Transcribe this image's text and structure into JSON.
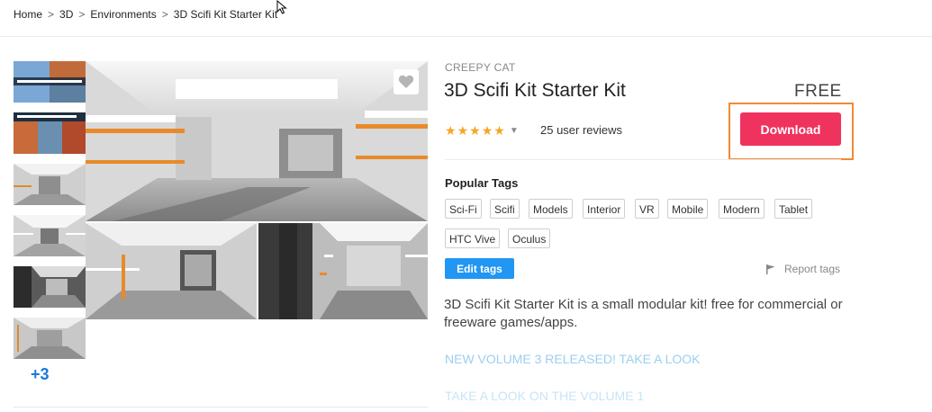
{
  "breadcrumb": {
    "items": [
      "Home",
      "3D",
      "Environments",
      "3D Scifi Kit Starter Kit"
    ],
    "separator": ">"
  },
  "gallery": {
    "more_count": "+3",
    "thumbnails": [
      {
        "icon": "thumbnail-volume-promo-1"
      },
      {
        "icon": "thumbnail-volume-promo-2"
      },
      {
        "icon": "thumbnail-corridor-1"
      },
      {
        "icon": "thumbnail-corridor-2"
      },
      {
        "icon": "thumbnail-corridor-3"
      },
      {
        "icon": "thumbnail-corridor-4"
      }
    ],
    "favorite_icon": "heart-icon"
  },
  "product": {
    "publisher": "CREEPY CAT",
    "title": "3D Scifi Kit Starter Kit",
    "price": "FREE",
    "rating_stars": 5,
    "reviews": "25 user reviews",
    "download_label": "Download",
    "popular_tags_heading": "Popular Tags",
    "tags": [
      "Sci-Fi",
      "Scifi",
      "Models",
      "Interior",
      "VR",
      "Mobile",
      "Modern",
      "Tablet",
      "HTC Vive",
      "Oculus"
    ],
    "edit_tags_label": "Edit tags",
    "report_tags_label": "Report tags",
    "description": "3D Scifi Kit Starter Kit is a small modular kit! free for commercial or freeware games/apps.",
    "link_1": "NEW VOLUME 3 RELEASED! TAKE A LOOK",
    "link_2": "TAKE A LOOK ON THE VOLUME 1"
  },
  "colors": {
    "download_button": "#f0335e",
    "highlight_border": "#f08a36",
    "edit_tags_button": "#2196f3",
    "star": "#f5a623",
    "link": "#9ccfef"
  }
}
